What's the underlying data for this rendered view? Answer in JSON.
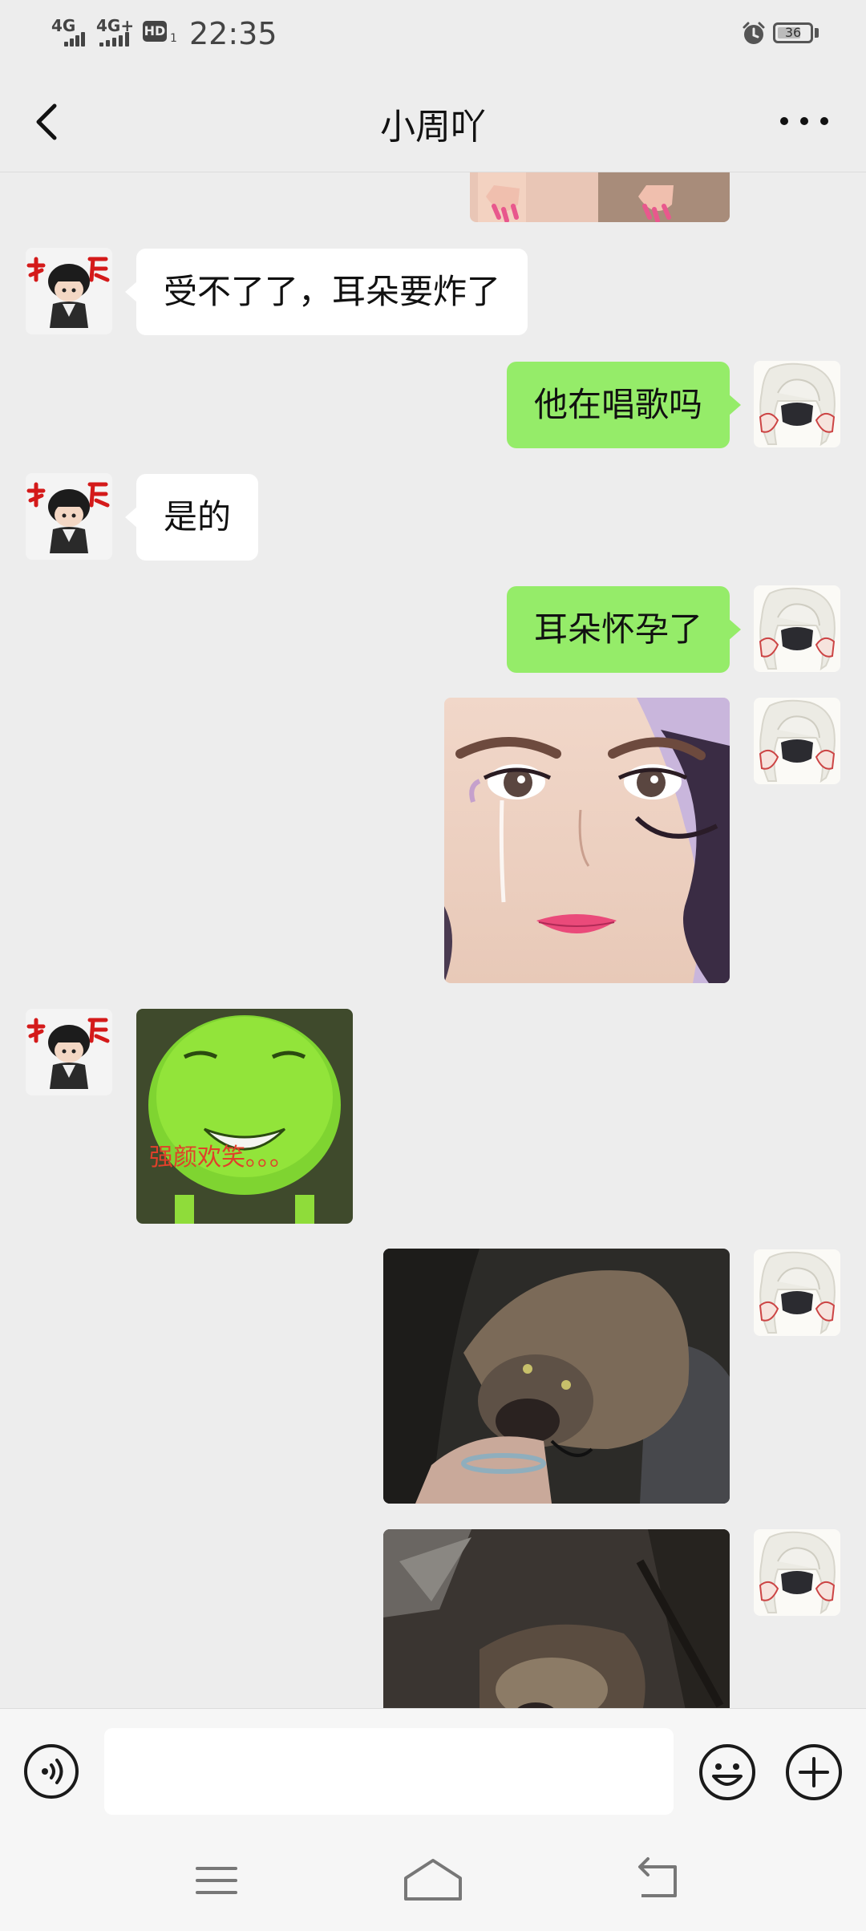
{
  "status_bar": {
    "sim1": "4G",
    "sim2": "4G+",
    "hd": "HD",
    "hd_sub": "1",
    "time": "22:35",
    "battery": "36"
  },
  "header": {
    "title": "小周吖",
    "back_icon": "chevron-left-icon",
    "more_icon": "more-horizontal-icon"
  },
  "messages": [
    {
      "side": "right",
      "type": "image",
      "content": "sticker-cropped-hands"
    },
    {
      "side": "left",
      "type": "text",
      "text": "受不了了，耳朵要炸了"
    },
    {
      "side": "right",
      "type": "text",
      "text": "他在唱歌吗"
    },
    {
      "side": "left",
      "type": "text",
      "text": "是的"
    },
    {
      "side": "right",
      "type": "text",
      "text": "耳朵怀孕了"
    },
    {
      "side": "right",
      "type": "image",
      "content": "sticker-crying-anime-girl"
    },
    {
      "side": "left",
      "type": "image",
      "content": "sticker-green-face",
      "caption": "强颜欢笑。。。"
    },
    {
      "side": "right",
      "type": "image",
      "content": "photo-dog-1"
    },
    {
      "side": "right",
      "type": "image",
      "content": "photo-dog-2"
    }
  ],
  "avatars": {
    "contact_badge": "打压",
    "contact": "avatar-chibi-boy",
    "me": "avatar-white-hair-character"
  },
  "input_bar": {
    "voice_icon": "voice-icon",
    "input_value": "",
    "emoji_icon": "emoji-icon",
    "plus_icon": "plus-circle-icon"
  },
  "nav_bar": {
    "menu_icon": "menu-icon",
    "home_icon": "home-icon",
    "back_icon": "return-icon"
  },
  "colors": {
    "background": "#ededed",
    "bubble_right": "#95ec69",
    "bubble_left": "#ffffff"
  }
}
